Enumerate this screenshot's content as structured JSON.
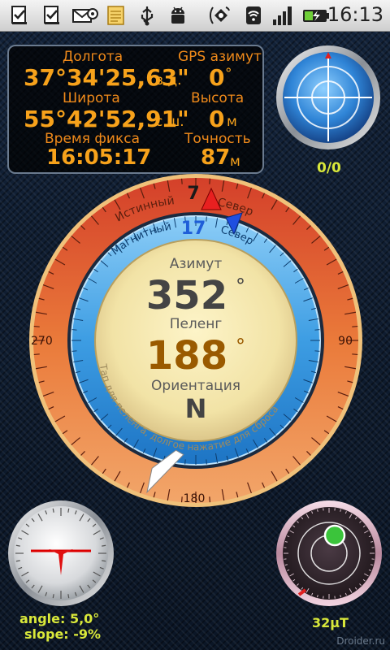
{
  "status_bar": {
    "time": "16:13",
    "icons": [
      "checklist-icon",
      "checklist-icon",
      "email-icon",
      "notes-icon",
      "usb-icon",
      "android-icon",
      "satellite-icon",
      "wifi-icon",
      "signal-icon",
      "battery-charging-icon"
    ]
  },
  "info_panel": {
    "longitude_label": "Долгота",
    "longitude_value": "37°34'25,63\"",
    "longitude_dir": "в.д.",
    "gps_azimuth_label": "GPS азимут",
    "gps_azimuth_value": "0",
    "gps_azimuth_unit": "°",
    "latitude_label": "Широта",
    "latitude_value": "55°42'52,91\"",
    "latitude_dir": "с.ш.",
    "altitude_label": "Высота",
    "altitude_value": "0",
    "altitude_unit": "м",
    "fix_time_label": "Время фикса",
    "fix_time_value": "16:05:17",
    "accuracy_label": "Точность",
    "accuracy_value": "87",
    "accuracy_unit": "м"
  },
  "satellites": {
    "count": "0/0"
  },
  "compass": {
    "true_label": "Истинный",
    "true_north_label": "Север",
    "true_value": "7",
    "magnetic_label": "Магнитный",
    "magnetic_north_label": "Север",
    "magnetic_value": "17",
    "azimuth_label": "Азимут",
    "azimuth_value": "352",
    "azimuth_unit": "°",
    "bearing_label": "Пеленг",
    "bearing_value": "188",
    "bearing_unit": "°",
    "orientation_label": "Ориентация",
    "orientation_value": "N",
    "hint_text": "Тап для пеленга, долгое нажатие для сброса",
    "tick_90": "90",
    "tick_180": "180",
    "tick_270": "270"
  },
  "level": {
    "angle_text": "angle: 5,0°",
    "slope_text": "slope: -9%"
  },
  "magnetometer": {
    "value_text": "32µT"
  },
  "watermark": "Droider.ru",
  "colors": {
    "accent_orange": "#f7a21b",
    "status_green": "#d9e83a",
    "ring_orange": "#e8672a",
    "ring_blue": "#2f95e0"
  }
}
